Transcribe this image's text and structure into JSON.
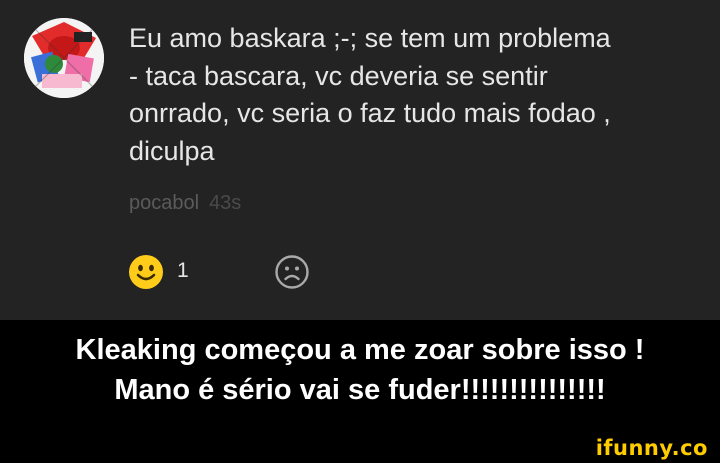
{
  "comment": {
    "lines": [
      "Eu amo baskara ;-; se tem um problema",
      "- taca bascara, vc deveria se sentir",
      "onrrado, vc seria o faz tudo mais fodao ,",
      "diculpa"
    ],
    "author": "pocabol",
    "time": "43s"
  },
  "reactions": {
    "smile_icon": "smile-emoji",
    "smile_count": "1",
    "frown_icon": "frown-outline"
  },
  "caption": {
    "line1": "Kleaking começou a me zoar sobre isso !",
    "line2": "Mano é sério vai se fuder!!!!!!!!!!!!!!!"
  },
  "watermark": "ifunny.co",
  "colors": {
    "panel_bg": "#232323",
    "text": "#e6e6e6",
    "muted": "#5b5b5b",
    "emoji_yellow": "#ffcc1a",
    "watermark": "#ffcc00"
  }
}
